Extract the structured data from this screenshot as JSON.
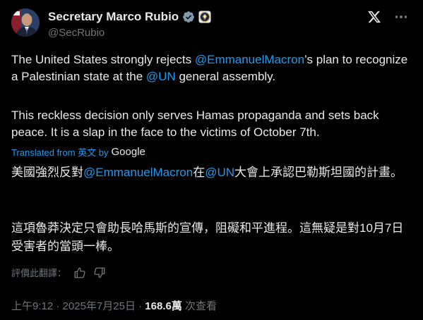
{
  "author": {
    "display_name": "Secretary Marco Rubio",
    "handle": "@SecRubio"
  },
  "post": {
    "line1_pre": "The United States strongly rejects ",
    "line1_mention": "@EmmanuelMacron",
    "line1_post": "’s plan to recognize a Palestinian state at the ",
    "line1_un": "@UN",
    "line1_end": " general assembly.",
    "paragraph2": "This reckless decision only serves Hamas propaganda and sets back peace. It is a slap in the face to the victims of October 7th."
  },
  "translation": {
    "label": "Translated from 英文 by",
    "provider": "Google",
    "zh1_pre": "美國強烈反對",
    "zh1_mention": "@EmmanuelMacron",
    "zh1_mid": "在",
    "zh1_un": "@UN",
    "zh1_post": "大會上承認巴勒斯坦國的計畫。",
    "zh2": "這項魯莽決定只會助長哈馬斯的宣傳，阻礙和平進程。這無疑是對10月7日受害者的當頭一棒。",
    "rate_label": "評價此翻譯："
  },
  "meta": {
    "time": "上午9:12",
    "separator1": " · ",
    "date": "2025年7月25日",
    "separator2": " · ",
    "views_count": "168.6萬",
    "views_label": " 次查看"
  },
  "icons": {
    "verified": "verified-badge-icon",
    "seal": "government-seal-icon",
    "x_logo": "x-logo-icon",
    "more": "more-options-icon",
    "thumbs_up": "thumbs-up-icon",
    "thumbs_down": "thumbs-down-icon"
  },
  "colors": {
    "background": "#000000",
    "text": "#e7e9ea",
    "secondary": "#71767b",
    "link": "#1d9bf0",
    "verified_badge": "#829aab"
  }
}
